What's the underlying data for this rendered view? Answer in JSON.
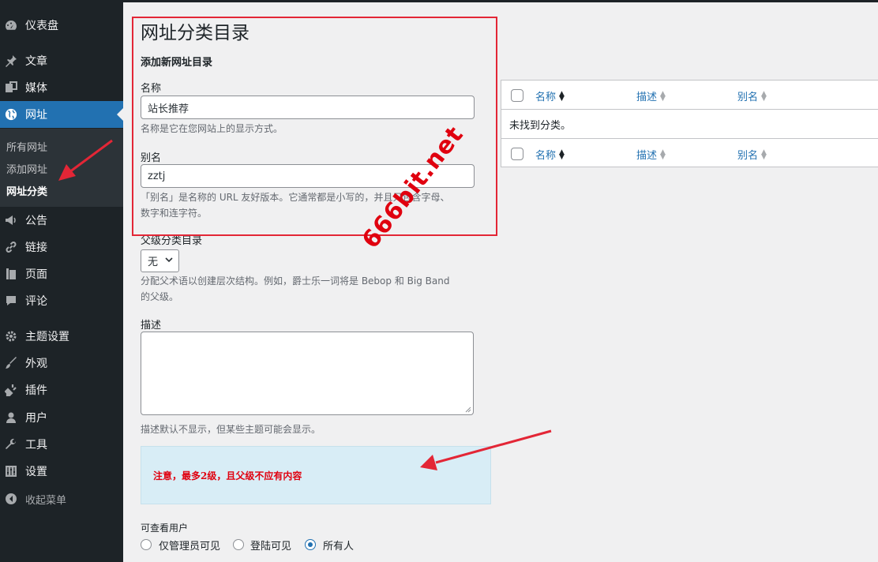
{
  "sidebar": {
    "items": [
      {
        "label": "仪表盘",
        "icon": "dashboard-icon"
      },
      {
        "label": "文章",
        "icon": "pin-icon"
      },
      {
        "label": "媒体",
        "icon": "media-icon"
      },
      {
        "label": "网址",
        "icon": "globe-icon"
      },
      {
        "label": "公告",
        "icon": "megaphone-icon"
      },
      {
        "label": "链接",
        "icon": "link-icon"
      },
      {
        "label": "页面",
        "icon": "page-icon"
      },
      {
        "label": "评论",
        "icon": "comment-icon"
      },
      {
        "label": "主题设置",
        "icon": "gear-icon"
      },
      {
        "label": "外观",
        "icon": "brush-icon"
      },
      {
        "label": "插件",
        "icon": "plug-icon"
      },
      {
        "label": "用户",
        "icon": "user-icon"
      },
      {
        "label": "工具",
        "icon": "wrench-icon"
      },
      {
        "label": "设置",
        "icon": "settings-icon"
      },
      {
        "label": "收起菜单",
        "icon": "collapse-icon"
      }
    ],
    "submenu": [
      "所有网址",
      "添加网址",
      "网址分类"
    ]
  },
  "form": {
    "page_title": "网址分类目录",
    "subtitle": "添加新网址目录",
    "name_label": "名称",
    "name_value": "站长推荐",
    "name_desc": "名称是它在您网站上的显示方式。",
    "slug_label": "别名",
    "slug_value": "zztj",
    "slug_desc_1": "「别名」是名称的 URL 友好版本。它通常都是小写的，并且只包含字母、",
    "slug_desc_2": "数字和连字符。",
    "parent_label": "父级分类目录",
    "parent_value": "无",
    "parent_desc_1": "分配父术语以创建层次结构。例如，爵士乐一词将是 Bebop 和 Big Band",
    "parent_desc_2": "的父级。",
    "desc_label": "描述",
    "desc_desc": "描述默认不显示，但某些主题可能会显示。",
    "notice": "注意，最多2级，且父级不应有内容",
    "visibility_label": "可查看用户",
    "visibility_options": [
      "仅管理员可见",
      "登陆可见",
      "所有人"
    ],
    "visibility_selected": "所有人"
  },
  "table": {
    "columns": [
      "名称",
      "描述",
      "别名"
    ],
    "empty": "未找到分类。"
  },
  "watermark": "666bit.net",
  "colors": {
    "accent": "#2271b1",
    "highlight": "#e32636",
    "sidebar": "#1d2327"
  }
}
